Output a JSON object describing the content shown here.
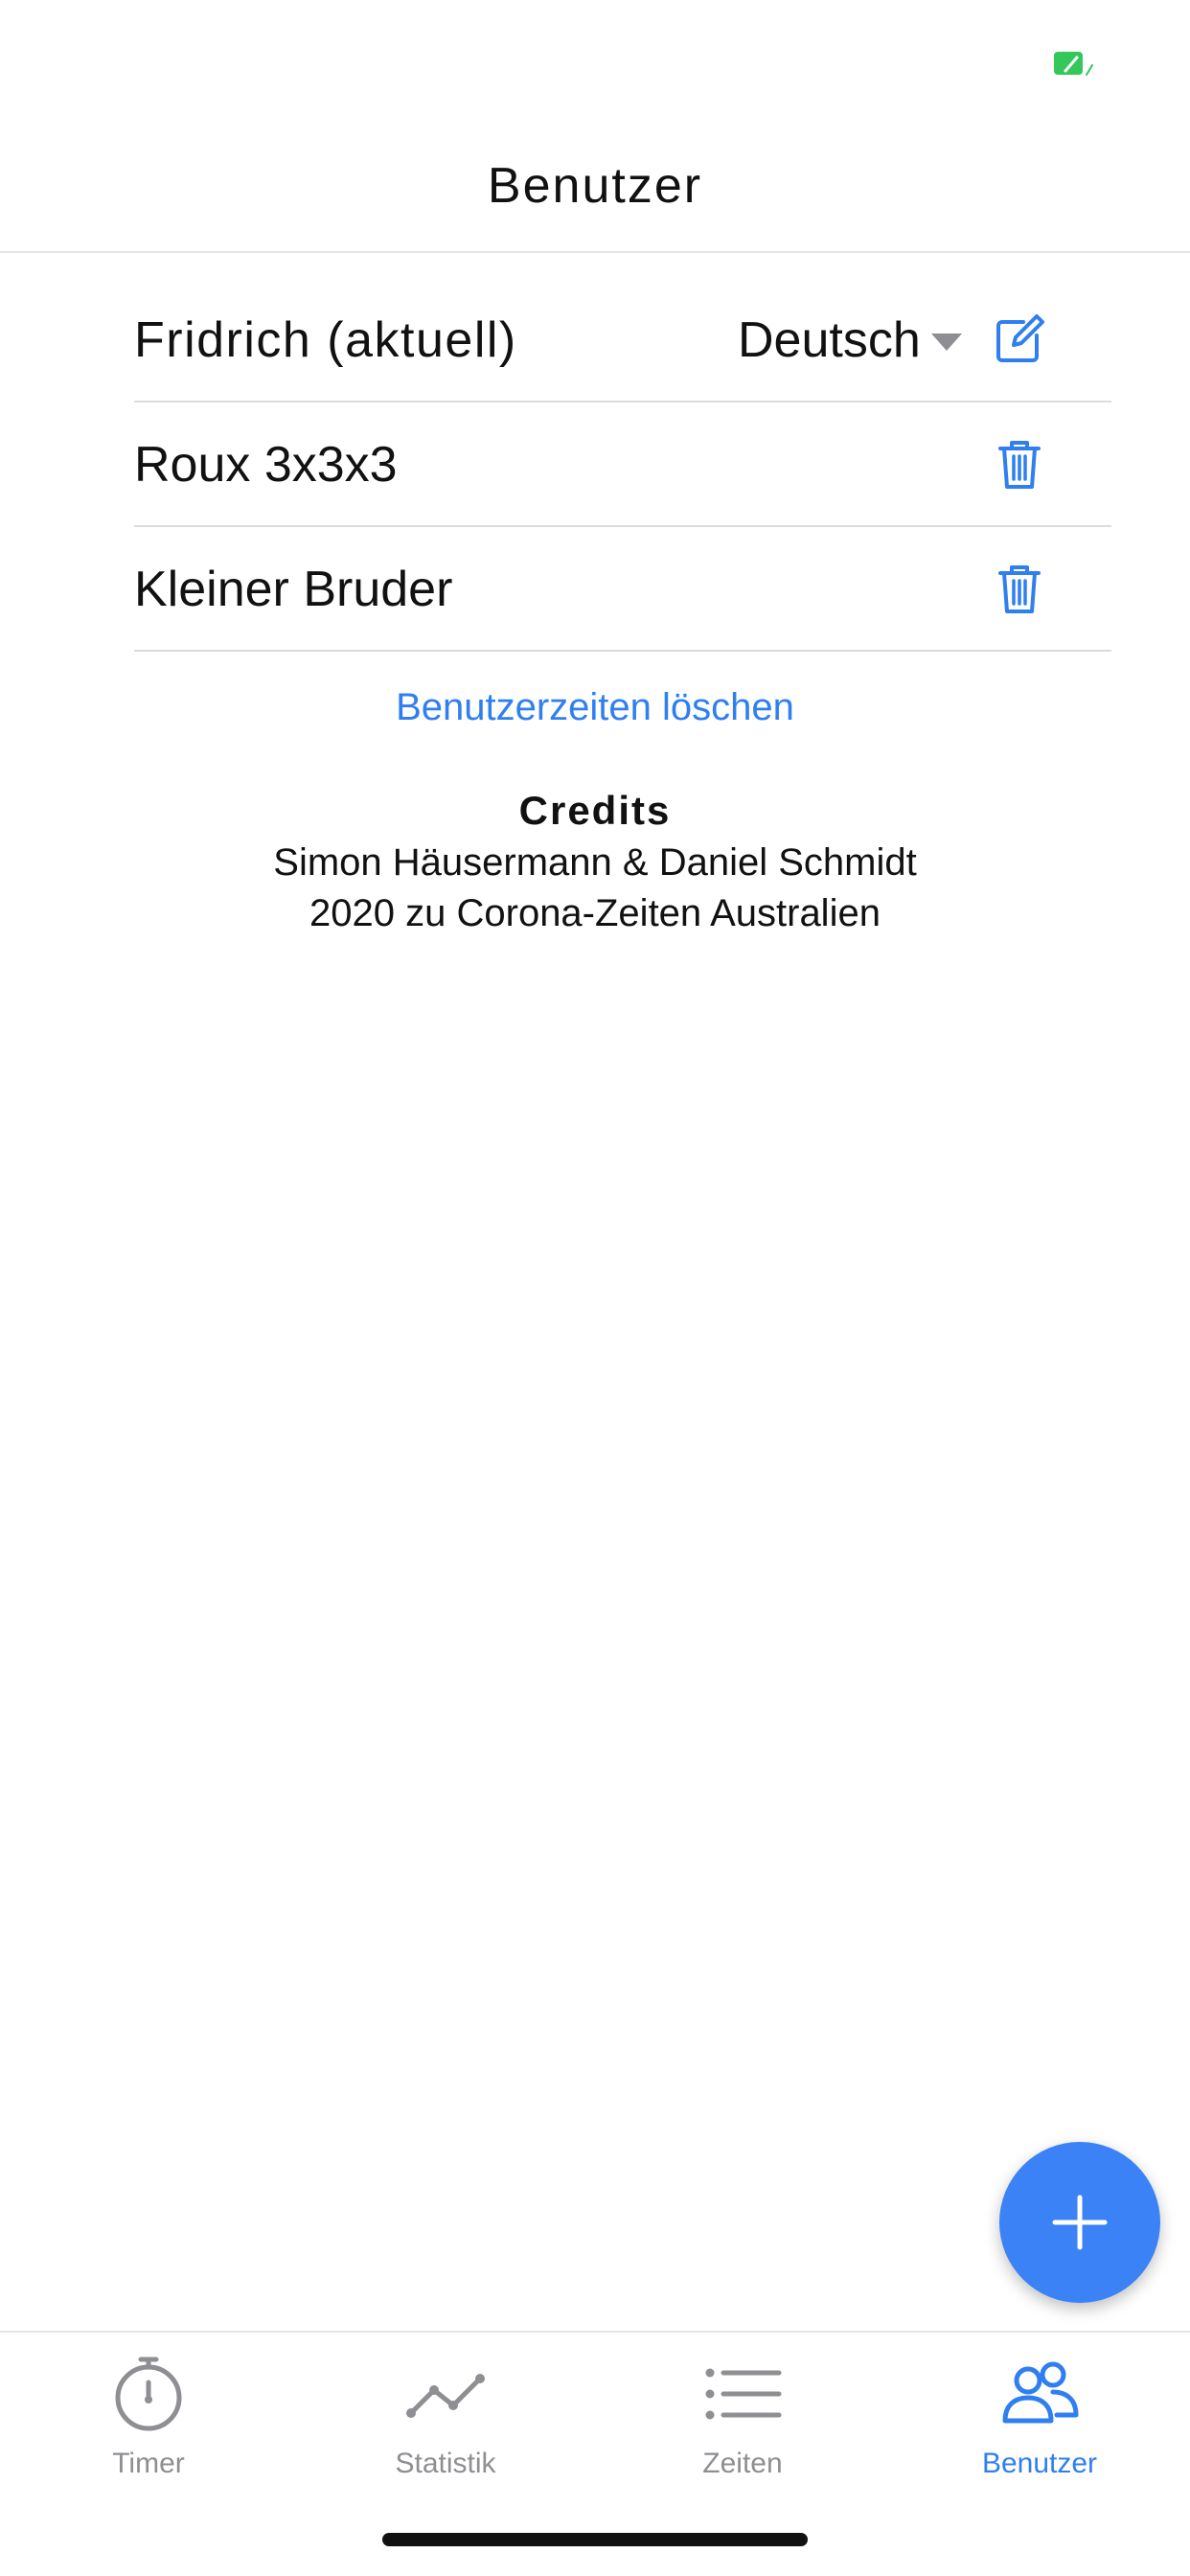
{
  "status_bar": {
    "battery_icon": "battery-charging-icon",
    "battery_color": "#34c759"
  },
  "header": {
    "title": "Benutzer"
  },
  "users": [
    {
      "name": "Fridrich (aktuell)",
      "current": true,
      "language": "Deutsch",
      "action_icon": "edit-icon"
    },
    {
      "name": "Roux 3x3x3",
      "current": false,
      "action_icon": "trash-icon"
    },
    {
      "name": "Kleiner Bruder",
      "current": false,
      "action_icon": "trash-icon"
    }
  ],
  "clear_times_label": "Benutzerzeiten löschen",
  "credits": {
    "title": "Credits",
    "line1": "Simon Häusermann & Daniel Schmidt",
    "line2": "2020 zu Corona-Zeiten Australien"
  },
  "fab": {
    "icon": "plus-icon"
  },
  "tabs": [
    {
      "label": "Timer",
      "icon": "stopwatch-icon",
      "active": false
    },
    {
      "label": "Statistik",
      "icon": "chart-line-icon",
      "active": false
    },
    {
      "label": "Zeiten",
      "icon": "list-icon",
      "active": false
    },
    {
      "label": "Benutzer",
      "icon": "users-icon",
      "active": true
    }
  ],
  "colors": {
    "accent": "#2f7ff0",
    "fab": "#3b82f6",
    "inactive": "#8e8e93"
  }
}
